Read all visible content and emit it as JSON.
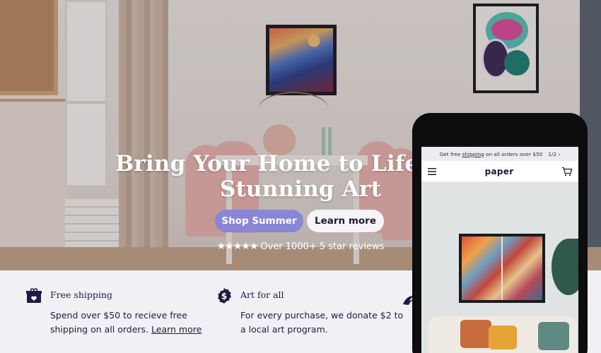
{
  "hero": {
    "headline_line1": "Bring Your Home to Life With",
    "headline_line2": "Stunning Art",
    "shop_button": "Shop Summer",
    "learn_button": "Learn more",
    "stars": "★★★★★",
    "reviews_text": "Over 1000+ 5 star reviews",
    "rating": 5
  },
  "features": [
    {
      "icon": "gift-box-heart-icon",
      "title": "Free shipping",
      "body": "Spend over $50 to recieve free shipping on all orders.",
      "link": "Learn more"
    },
    {
      "icon": "dollar-badge-icon",
      "title": "Art for all",
      "body": "For every purchase, we donate $2 to a local art program."
    },
    {
      "icon": "wave-icon"
    }
  ],
  "phone": {
    "announcement_prefix": "Get free",
    "announcement_link": "shipping",
    "announcement_suffix": "on all orders over $50",
    "pager": "1/2",
    "logo": "paper",
    "menu_icon": "hamburger-menu-icon",
    "cart_icon": "cart-icon"
  },
  "colors": {
    "primary_button": "#8a86d6",
    "ink": "#1e1b44",
    "features_bg": "#f1f1f5"
  }
}
